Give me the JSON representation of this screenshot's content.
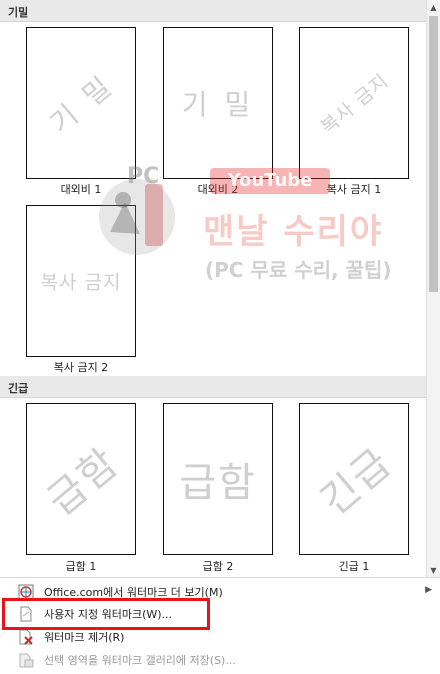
{
  "sections": [
    {
      "label": "기밀"
    },
    {
      "label": "긴급"
    }
  ],
  "watermarks": [
    {
      "caption": "대외비 1",
      "text": "기 밀"
    },
    {
      "caption": "대외비 2",
      "text": "기 밀"
    },
    {
      "caption": "복사 금지 1",
      "text": "복사 금지"
    },
    {
      "caption": "복사 금지 2",
      "text": "복사 금지"
    },
    {
      "caption": "급함 1",
      "text": "급함"
    },
    {
      "caption": "급함 2",
      "text": "급함"
    },
    {
      "caption": "긴급 1",
      "text": "긴급"
    }
  ],
  "menu": [
    {
      "label": "Office.com에서 워터마크 더 보기(M)",
      "icon": "office-globe-icon",
      "disabled": false,
      "has_submenu": true
    },
    {
      "label": "사용자 지정 워터마크(W)...",
      "icon": "custom-watermark-icon",
      "disabled": false,
      "highlighted": true
    },
    {
      "label": "워터마크 제거(R)",
      "icon": "remove-watermark-icon",
      "disabled": false
    },
    {
      "label": "선택 영역을 워터마크 갤러리에 저장(S)...",
      "icon": "save-to-gallery-icon",
      "disabled": true
    }
  ],
  "overlay": {
    "pc": "PC",
    "youtube": "YouTube",
    "title": "맨날 수리야",
    "subtitle": "(PC 무료 수리, 꿀팁)",
    "mascot_text": "수리야"
  },
  "colors": {
    "section_bg": "#e9e9e9",
    "highlight": "#e8141b",
    "watermark_gray": "#cfcfcf"
  }
}
